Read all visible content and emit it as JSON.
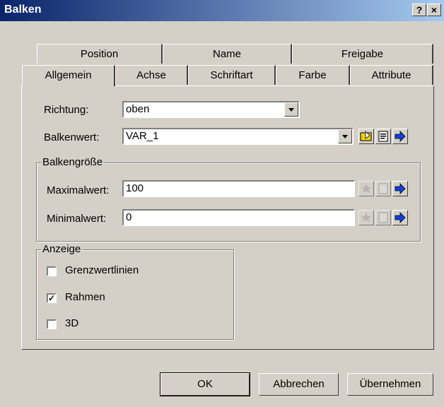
{
  "window": {
    "title": "Balken",
    "help_label": "?",
    "close_label": "×"
  },
  "tabs_row1": [
    "Position",
    "Name",
    "Freigabe"
  ],
  "tabs_row2": [
    "Allgemein",
    "Achse",
    "Schriftart",
    "Farbe",
    "Attribute"
  ],
  "richtung": {
    "label": "Richtung:",
    "value": "oben"
  },
  "balkenwert": {
    "label": "Balkenwert:",
    "value": "VAR_1"
  },
  "balkengroesse": {
    "group_label": "Balkengröße",
    "max_label": "Maximalwert:",
    "max_value": "100",
    "min_label": "Minimalwert:",
    "min_value": "0"
  },
  "anzeige": {
    "group_label": "Anzeige",
    "items": [
      {
        "label": "Grenzwertlinien",
        "checked": false
      },
      {
        "label": "Rahmen",
        "checked": true
      },
      {
        "label": "3D",
        "checked": false
      }
    ]
  },
  "buttons": {
    "ok": "OK",
    "cancel": "Abbrechen",
    "apply": "Übernehmen"
  },
  "check_mark": "✓",
  "icons": {
    "browse": "folder-var-icon",
    "properties": "properties-icon",
    "link": "arrow-right-icon"
  },
  "colors": {
    "title_start": "#0a246a",
    "title_end": "#a6caf0",
    "face": "#d4d0c8"
  }
}
